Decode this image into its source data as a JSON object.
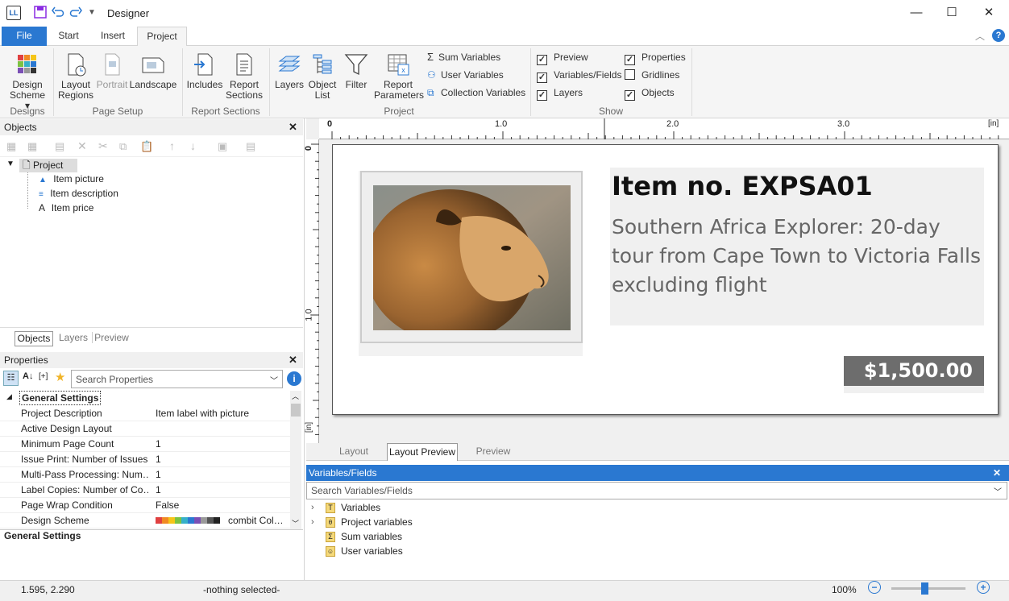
{
  "app": {
    "icon_text": "LL",
    "title": "Designer"
  },
  "tabs": {
    "file": "File",
    "start": "Start",
    "insert": "Insert",
    "project": "Project"
  },
  "ribbon": {
    "design_scheme": "Design\nScheme ▾",
    "layout_regions": "Layout\nRegions",
    "portrait": "Portrait",
    "landscape": "Landscape",
    "includes": "Includes",
    "report_sections": "Report\nSections",
    "layers": "Layers",
    "object_list": "Object\nList",
    "filter": "Filter",
    "report_parameters": "Report\nParameters",
    "sum_variables": "Sum Variables",
    "user_variables": "User Variables",
    "collection_variables": "Collection Variables",
    "show_preview": "Preview",
    "show_variables_fields": "Variables/Fields",
    "show_layers": "Layers",
    "show_properties": "Properties",
    "show_gridlines": "Gridlines",
    "show_objects": "Objects",
    "groups": {
      "designs": "Designs",
      "page_setup": "Page Setup",
      "report_sections": "Report Sections",
      "project": "Project",
      "show": "Show"
    }
  },
  "objects_panel": {
    "title": "Objects",
    "tree": {
      "root": "Project",
      "items": [
        "Item picture",
        "Item description",
        "Item price"
      ]
    },
    "tabs": [
      "Objects",
      "Layers",
      "Preview"
    ]
  },
  "properties_panel": {
    "title": "Properties",
    "search_placeholder": "Search Properties",
    "section": "General Settings",
    "rows": [
      {
        "k": "Project Description",
        "v": "Item label with picture"
      },
      {
        "k": "Active Design Layout",
        "v": ""
      },
      {
        "k": "Minimum Page Count",
        "v": "1"
      },
      {
        "k": "Issue Print: Number of Issues",
        "v": "1"
      },
      {
        "k": "Multi-Pass Processing: Num…",
        "v": "1"
      },
      {
        "k": "Label Copies: Number of Co…",
        "v": "1"
      },
      {
        "k": "Page Wrap Condition",
        "v": "False"
      },
      {
        "k": "Design Scheme",
        "v": "combit Col…"
      }
    ],
    "footer": "General Settings",
    "scheme_colors": [
      "#e04040",
      "#f08a24",
      "#f5c518",
      "#7cc242",
      "#36b0c9",
      "#2a78d1",
      "#7a4fb5",
      "#999999",
      "#555555",
      "#222222"
    ]
  },
  "ruler": {
    "labels": [
      "0",
      "1.0",
      "2.0",
      "3.0"
    ],
    "unit": "[in]",
    "v_labels": [
      "0",
      "1.0"
    ],
    "v_unit": "[in]"
  },
  "label": {
    "item_no": "Item no. EXPSA01",
    "description": "Southern Africa Explorer: 20-day tour from Cape Town to Victoria Falls excluding flight",
    "price": "$1,500.00"
  },
  "bottom_tabs": [
    "Layout",
    "Layout Preview",
    "Preview"
  ],
  "varfields": {
    "title": "Variables/Fields",
    "search_placeholder": "Search Variables/Fields",
    "items": [
      "Variables",
      "Project variables",
      "Sum variables",
      "User variables"
    ]
  },
  "status": {
    "coords": "1.595, 2.290",
    "selection": "-nothing selected-",
    "zoom": "100%",
    "zoom_level": 0.45
  }
}
